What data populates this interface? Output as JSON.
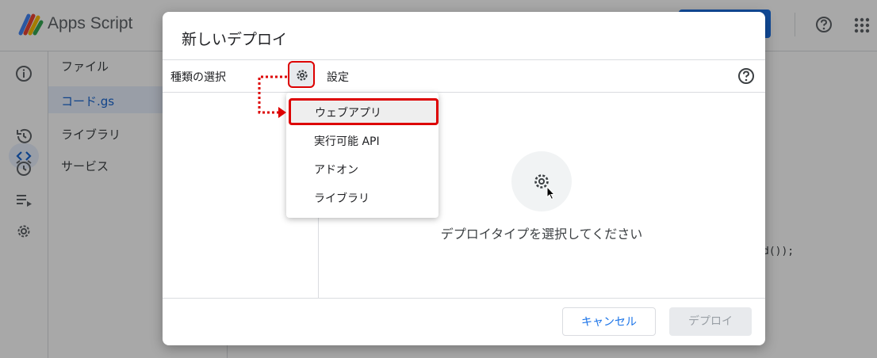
{
  "app": {
    "title": "Apps Script",
    "brand_colors": [
      "#4285f4",
      "#ea4335",
      "#fbbc04",
      "#34a853"
    ]
  },
  "sidebar": {
    "icons": [
      "info-icon",
      "code-icon",
      "history-icon",
      "alarm-icon",
      "executions-icon",
      "settings-icon"
    ]
  },
  "files": {
    "items": [
      {
        "label": "ファイル"
      },
      {
        "label": "コード.gs"
      },
      {
        "label": "ライブラリ"
      },
      {
        "label": "サービス"
      }
    ]
  },
  "editor": {
    "visible_code": "d());"
  },
  "dialog": {
    "title": "新しいデプロイ",
    "type_select_label": "種類の選択",
    "settings_label": "設定",
    "empty_message": "デプロイタイプを選択してください",
    "cancel_label": "キャンセル",
    "deploy_label": "デプロイ"
  },
  "menu": {
    "items": [
      {
        "label": "ウェブアプリ",
        "selected": true
      },
      {
        "label": "実行可能 API"
      },
      {
        "label": "アドオン"
      },
      {
        "label": "ライブラリ"
      }
    ]
  },
  "colors": {
    "accent": "#1a73e8",
    "highlight": "#dd0000",
    "disabled": "#9aa0a6"
  }
}
